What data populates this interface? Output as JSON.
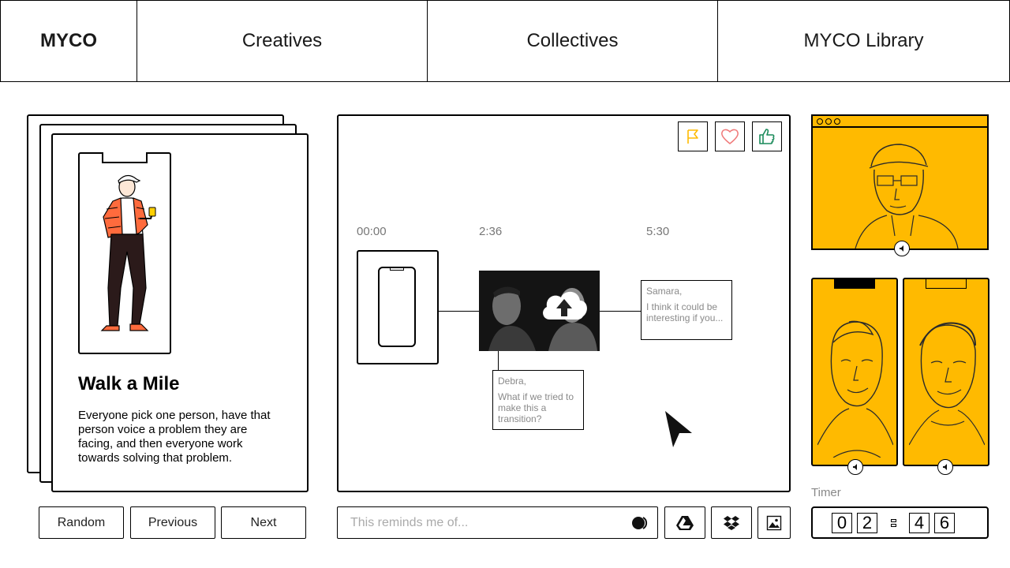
{
  "nav": {
    "logo": "MYCO",
    "tabs": [
      "Creatives",
      "Collectives",
      "MYCO Library"
    ]
  },
  "card": {
    "title": "Walk a Mile",
    "description": "Everyone pick one person, have that person voice a problem they are facing, and then everyone work towards solving that problem."
  },
  "card_buttons": {
    "random": "Random",
    "previous": "Previous",
    "next": "Next"
  },
  "timeline": {
    "times": [
      "00:00",
      "2:36",
      "5:30"
    ],
    "notes": [
      {
        "author": "Samara,",
        "text": "I think it could be interesting if you..."
      },
      {
        "author": "Debra,",
        "text": "What if we tried to make this a transition?"
      }
    ]
  },
  "reactions": [
    "flag-icon",
    "heart-icon",
    "thumbs-up-icon"
  ],
  "colors": {
    "accent": "#ffba00",
    "flag": "#ffba00",
    "heart": "#f07b7b",
    "thumb": "#1a8a5a"
  },
  "comment": {
    "placeholder": "This reminds me of..."
  },
  "timer": {
    "label": "Timer",
    "digits": [
      "0",
      "2",
      "4",
      "6"
    ]
  }
}
